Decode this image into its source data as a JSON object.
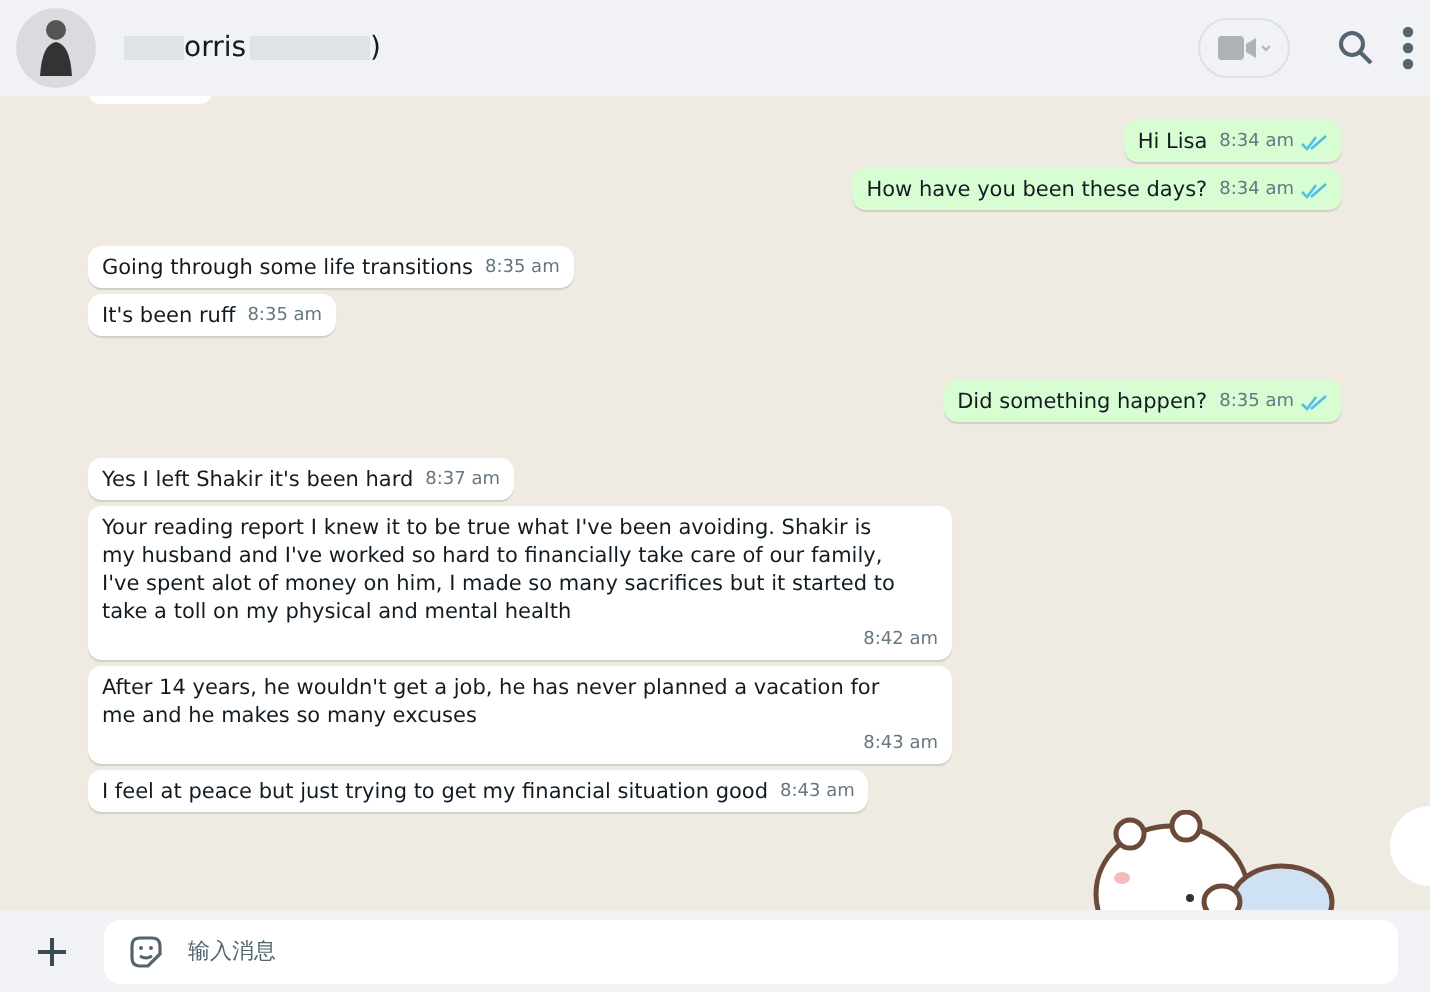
{
  "header": {
    "name_visible": "orris",
    "name_end": ")"
  },
  "messages": [
    {
      "text": "Hi Lisa",
      "time": "8:34 am",
      "outgoing": true,
      "read": true
    },
    {
      "text": "How have you been these days?",
      "time": "8:34 am",
      "outgoing": true,
      "read": true
    },
    {
      "text": "Going through some life transitions",
      "time": "8:35 am",
      "outgoing": false
    },
    {
      "text": "It's been ruff",
      "time": "8:35 am",
      "outgoing": false
    },
    {
      "text": "Did something happen?",
      "time": "8:35 am",
      "outgoing": true,
      "read": true
    },
    {
      "text": "Yes I left Shakir it's been hard",
      "time": "8:37 am",
      "outgoing": false
    },
    {
      "text": "Your reading report I knew it to be true what I've been avoiding. Shakir is my husband and I've worked so hard to financially take care of our family, I've spent alot of money on him, I made so many sacrifices but it started to take a toll on my physical and mental health",
      "time": "8:42 am",
      "outgoing": false
    },
    {
      "text": "After 14 years, he wouldn't get a job, he has never planned a vacation for me and he makes so many excuses",
      "time": "8:43 am",
      "outgoing": false
    },
    {
      "text": "I feel at peace but just trying to get my financial situation good",
      "time": "8:43 am",
      "outgoing": false
    }
  ],
  "composer": {
    "placeholder": "输入消息"
  }
}
